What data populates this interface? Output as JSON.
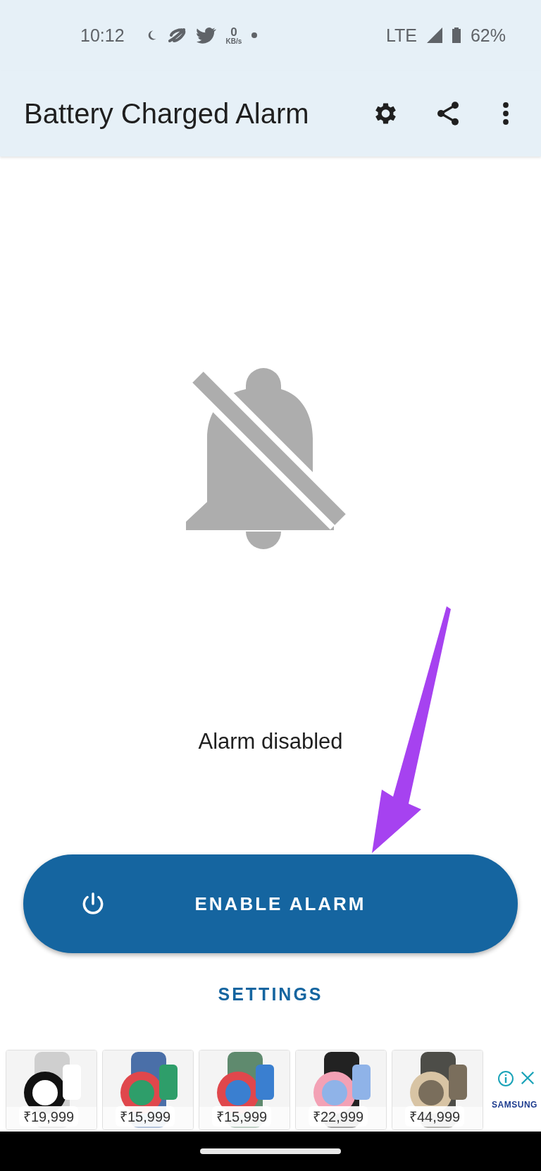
{
  "status_bar": {
    "time": "10:12",
    "data_rate": "0",
    "data_unit": "KB/s",
    "network": "LTE",
    "battery": "62%"
  },
  "app_bar": {
    "title": "Battery Charged Alarm"
  },
  "alarm": {
    "enabled": false,
    "status": "Alarm disabled"
  },
  "buttons": {
    "enable": "ENABLE ALARM",
    "settings": "SETTINGS"
  },
  "ad": {
    "brand": "SAMSUNG",
    "products": [
      {
        "kind": "picture",
        "price": "₹19,999"
      },
      {
        "kind": "picture",
        "price": "₹15,999"
      },
      {
        "kind": "picture",
        "price": "₹15,999"
      },
      {
        "kind": "picture",
        "price": "₹22,999"
      },
      {
        "kind": "picture",
        "price": "₹44,999"
      }
    ]
  }
}
